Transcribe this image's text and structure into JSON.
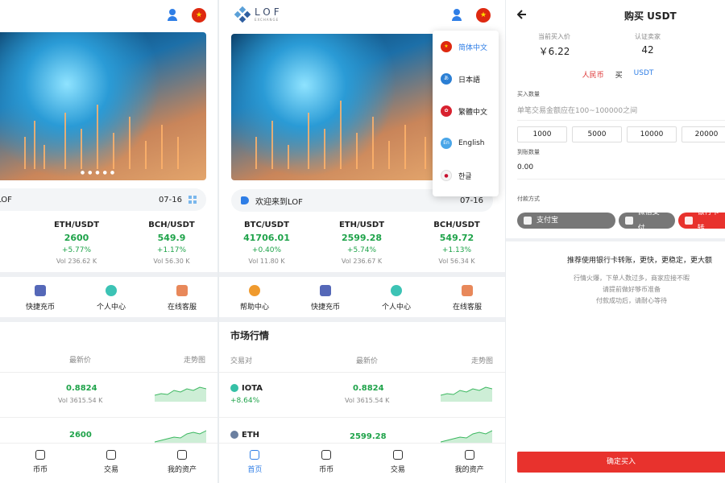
{
  "screen1": {
    "notice": "LOF",
    "notice_date": "07-16",
    "tickers": [
      {
        "pair": "ETH/USDT",
        "price": "2600",
        "change": "+5.77%",
        "vol": "Vol 236.62 K"
      },
      {
        "pair": "BCH/USDT",
        "price": "549.9",
        "change": "+1.17%",
        "vol": "Vol 56.30 K"
      }
    ],
    "quick": [
      {
        "label": "快捷充币"
      },
      {
        "label": "个人中心"
      },
      {
        "label": "在线客服"
      }
    ],
    "market_head": {
      "price": "最新价",
      "trend": "走势图"
    },
    "rows": [
      {
        "price": "0.8824",
        "vol": "Vol 3615.54 K"
      },
      {
        "price": "2600"
      }
    ],
    "tabs": [
      {
        "label": "币币"
      },
      {
        "label": "交易"
      },
      {
        "label": "我的资产"
      }
    ]
  },
  "screen2": {
    "logo": "LOF",
    "logo_sub": "EXCHANGE",
    "notice": "欢迎来到LOF",
    "notice_date": "07-16",
    "tickers": [
      {
        "pair": "BTC/USDT",
        "price": "41706.01",
        "change": "+0.40%",
        "vol": "Vol 11.80 K"
      },
      {
        "pair": "ETH/USDT",
        "price": "2599.28",
        "change": "+5.74%",
        "vol": "Vol 236.67 K"
      },
      {
        "pair": "BCH/USDT",
        "price": "549.72",
        "change": "+1.13%",
        "vol": "Vol 56.34 K"
      }
    ],
    "quick": [
      {
        "label": "帮助中心"
      },
      {
        "label": "快捷充币"
      },
      {
        "label": "个人中心"
      },
      {
        "label": "在线客服"
      }
    ],
    "market_title": "市场行情",
    "market_head": {
      "pair": "交易对",
      "price": "最新价",
      "trend": "走势图"
    },
    "rows": [
      {
        "name": "IOTA",
        "change": "+8.64%",
        "price": "0.8824",
        "vol": "Vol 3615.54 K"
      },
      {
        "name": "ETH",
        "price": "2599.28"
      }
    ],
    "tabs": [
      {
        "label": "首页"
      },
      {
        "label": "币币"
      },
      {
        "label": "交易"
      },
      {
        "label": "我的资产"
      }
    ],
    "languages": [
      {
        "label": "简体中文",
        "flag": "cn",
        "active": true
      },
      {
        "label": "日本語",
        "flag": "jp",
        "active": false
      },
      {
        "label": "繁體中文",
        "flag": "hk",
        "active": false
      },
      {
        "label": "English",
        "flag": "en",
        "active": false
      },
      {
        "label": "한글",
        "flag": "kr",
        "active": false
      }
    ]
  },
  "screen3": {
    "title": "购买 USDT",
    "stats": [
      {
        "label": "当前买入价",
        "value": "￥6.22"
      },
      {
        "label": "认证卖家",
        "value": "42"
      }
    ],
    "tabs": [
      "人民币",
      "买",
      "USDT"
    ],
    "buy_amount_label": "买入数量",
    "buy_amount_placeholder": "单笔交易金额应在100~100000之间",
    "amounts": [
      "1000",
      "5000",
      "10000",
      "20000"
    ],
    "receive_label": "到账数量",
    "receive_value": "0.00",
    "pay_method_label": "付款方式",
    "pay_methods": [
      {
        "label": "支付宝"
      },
      {
        "label": "微信支付"
      },
      {
        "label": "银行卡转"
      }
    ],
    "tip_main": "推荐使用银行卡转账，更快，更稳定，更大额",
    "tips": [
      "行情火爆，下单人数过多，商家应接不暇",
      "请提前做好够币准备",
      "付款成功后，请耐心等待"
    ],
    "confirm": "确定买入"
  },
  "colors": {
    "accent": "#2f7ee6",
    "up": "#1fa34a",
    "danger": "#e8322d"
  }
}
